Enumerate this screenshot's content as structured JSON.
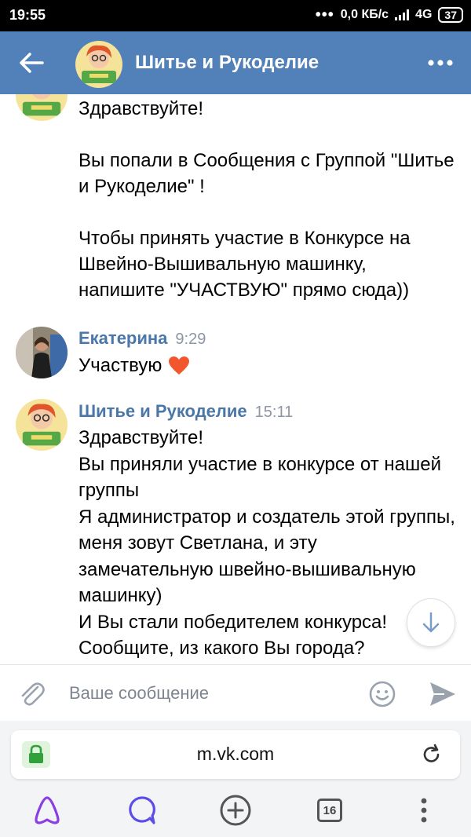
{
  "status_bar": {
    "time": "19:55",
    "dots": "•••",
    "speed": "0,0 КБ/с",
    "network": "4G",
    "battery": "37"
  },
  "header": {
    "title": "Шитье и Рукоделие",
    "back_icon": "arrow-left-icon",
    "more_icon": "more-dots-icon",
    "color": "#5181b8"
  },
  "messages": {
    "first": {
      "lines": "Здравствуйте!\n\nВы попали в Сообщения с Группой \"Шитье и Рукоделие\" !\n\nЧтобы принять участие в Конкурсе на Швейно-Вышивальную машинку, напишите \"УЧАСТВУЮ\" прямо сюда))"
    },
    "second": {
      "author": "Екатерина",
      "time": "9:29",
      "text": "Участвую",
      "emoji": "heart-icon"
    },
    "third": {
      "author": "Шитье и Рукоделие",
      "time": "15:11",
      "text": "Здравствуйте!\nВы приняли участие в конкурсе от нашей группы\nЯ администратор и создатель этой группы, меня зовут Светлана, и эту замечательную швейно-вышивальную машинку)\nИ Вы стали победителем конкурса!\nСообщите, из какого Вы города?"
    }
  },
  "composer": {
    "placeholder": "Ваше сообщение",
    "attach_icon": "paperclip-icon",
    "emoji_icon": "smiley-icon",
    "send_icon": "send-icon"
  },
  "browser": {
    "url": "m.vk.com",
    "tabs_count": "16",
    "accent": "#7b3fe4"
  }
}
